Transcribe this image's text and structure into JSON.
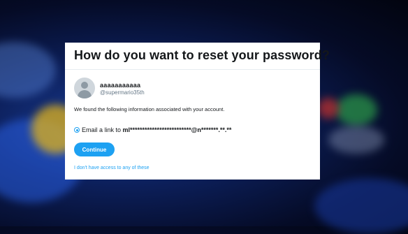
{
  "dialog": {
    "title": "How do you want to reset your password?",
    "account": {
      "name": "aaaaaaaaaaa",
      "handle": "@supermario35th"
    },
    "info_text": "We found the following information associated with your account.",
    "option": {
      "prefix": "Email a link to ",
      "masked_email": "ml*************************@n*******.**.**",
      "selected": true
    },
    "continue_label": "Continue",
    "no_access_link": "I don't have access to any of these"
  },
  "colors": {
    "accent": "#1da1f2",
    "text": "#14171a",
    "muted": "#657786"
  },
  "icons": {
    "avatar": "default-profile-icon",
    "radio": "radio-selected-icon"
  }
}
